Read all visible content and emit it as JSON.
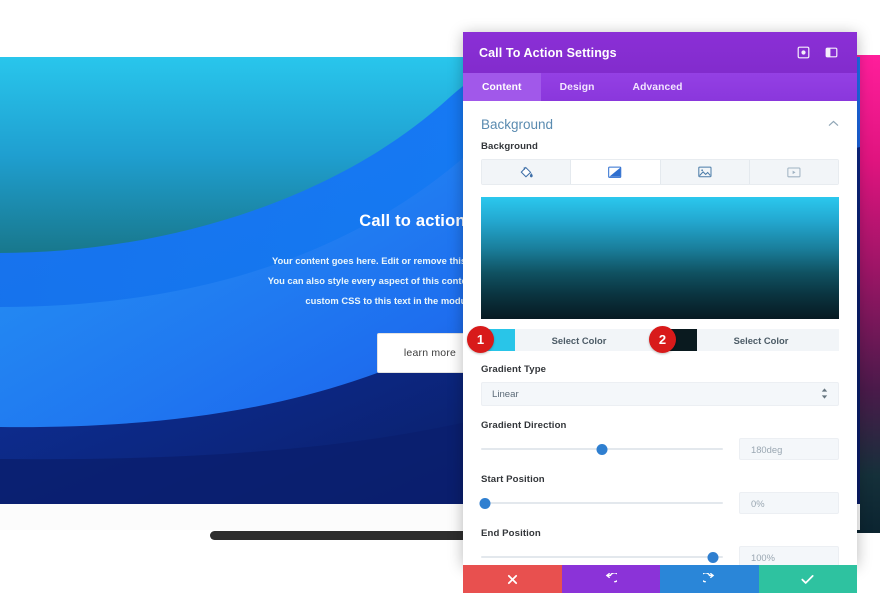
{
  "preview": {
    "cta_title": "Call to action title",
    "cta_body_line1": "Your content goes here. Edit or remove this text inline or in the module",
    "cta_body_line2": "You can also style every aspect of this content in the module Design sett",
    "cta_body_line3": "custom CSS to this text in the module Advanced setting",
    "cta_button_label": "learn more"
  },
  "modal": {
    "title": "Call To Action Settings",
    "header_icons": [
      {
        "name": "expand-icon"
      },
      {
        "name": "panel-layout-icon"
      }
    ],
    "tabs": [
      {
        "label": "Content",
        "active": true
      },
      {
        "label": "Design",
        "active": false
      },
      {
        "label": "Advanced",
        "active": false
      }
    ],
    "section": {
      "title": "Background",
      "collapse_icon": "chevron-up-icon"
    },
    "background_field": {
      "label": "Background",
      "tabs": [
        {
          "name": "background-color-tab",
          "icon": "paint-bucket-icon",
          "active": false
        },
        {
          "name": "background-gradient-tab",
          "icon": "gradient-icon",
          "active": true
        },
        {
          "name": "background-image-tab",
          "icon": "image-icon",
          "active": false
        },
        {
          "name": "background-video-tab",
          "icon": "video-icon",
          "active": false
        }
      ]
    },
    "gradient_preview": {
      "top_color": "#2bc8ee",
      "bottom_color": "#071a22"
    },
    "colors": [
      {
        "badge": "1",
        "swatch": "#29c5e8",
        "label": "Select Color"
      },
      {
        "badge": "2",
        "swatch": "#0a1a1f",
        "label": "Select Color"
      }
    ],
    "gradient_type": {
      "label": "Gradient Type",
      "value": "Linear"
    },
    "sliders": [
      {
        "label": "Gradient Direction",
        "value": "180deg",
        "percent": 50
      },
      {
        "label": "Start Position",
        "value": "0%",
        "percent": 1
      },
      {
        "label": "End Position",
        "value": "100%",
        "percent": 98
      }
    ],
    "footer_buttons": [
      {
        "name": "cancel-button",
        "icon": "close-icon"
      },
      {
        "name": "undo-button",
        "icon": "undo-icon"
      },
      {
        "name": "redo-button",
        "icon": "redo-icon"
      },
      {
        "name": "save-button",
        "icon": "check-icon"
      }
    ]
  },
  "colors": {
    "accent_purple": "#8a2be2",
    "badge_red": "#d81a1a",
    "save_green": "#2ec2a0",
    "cancel_red": "#e8504f",
    "redo_blue": "#2a86d8"
  }
}
